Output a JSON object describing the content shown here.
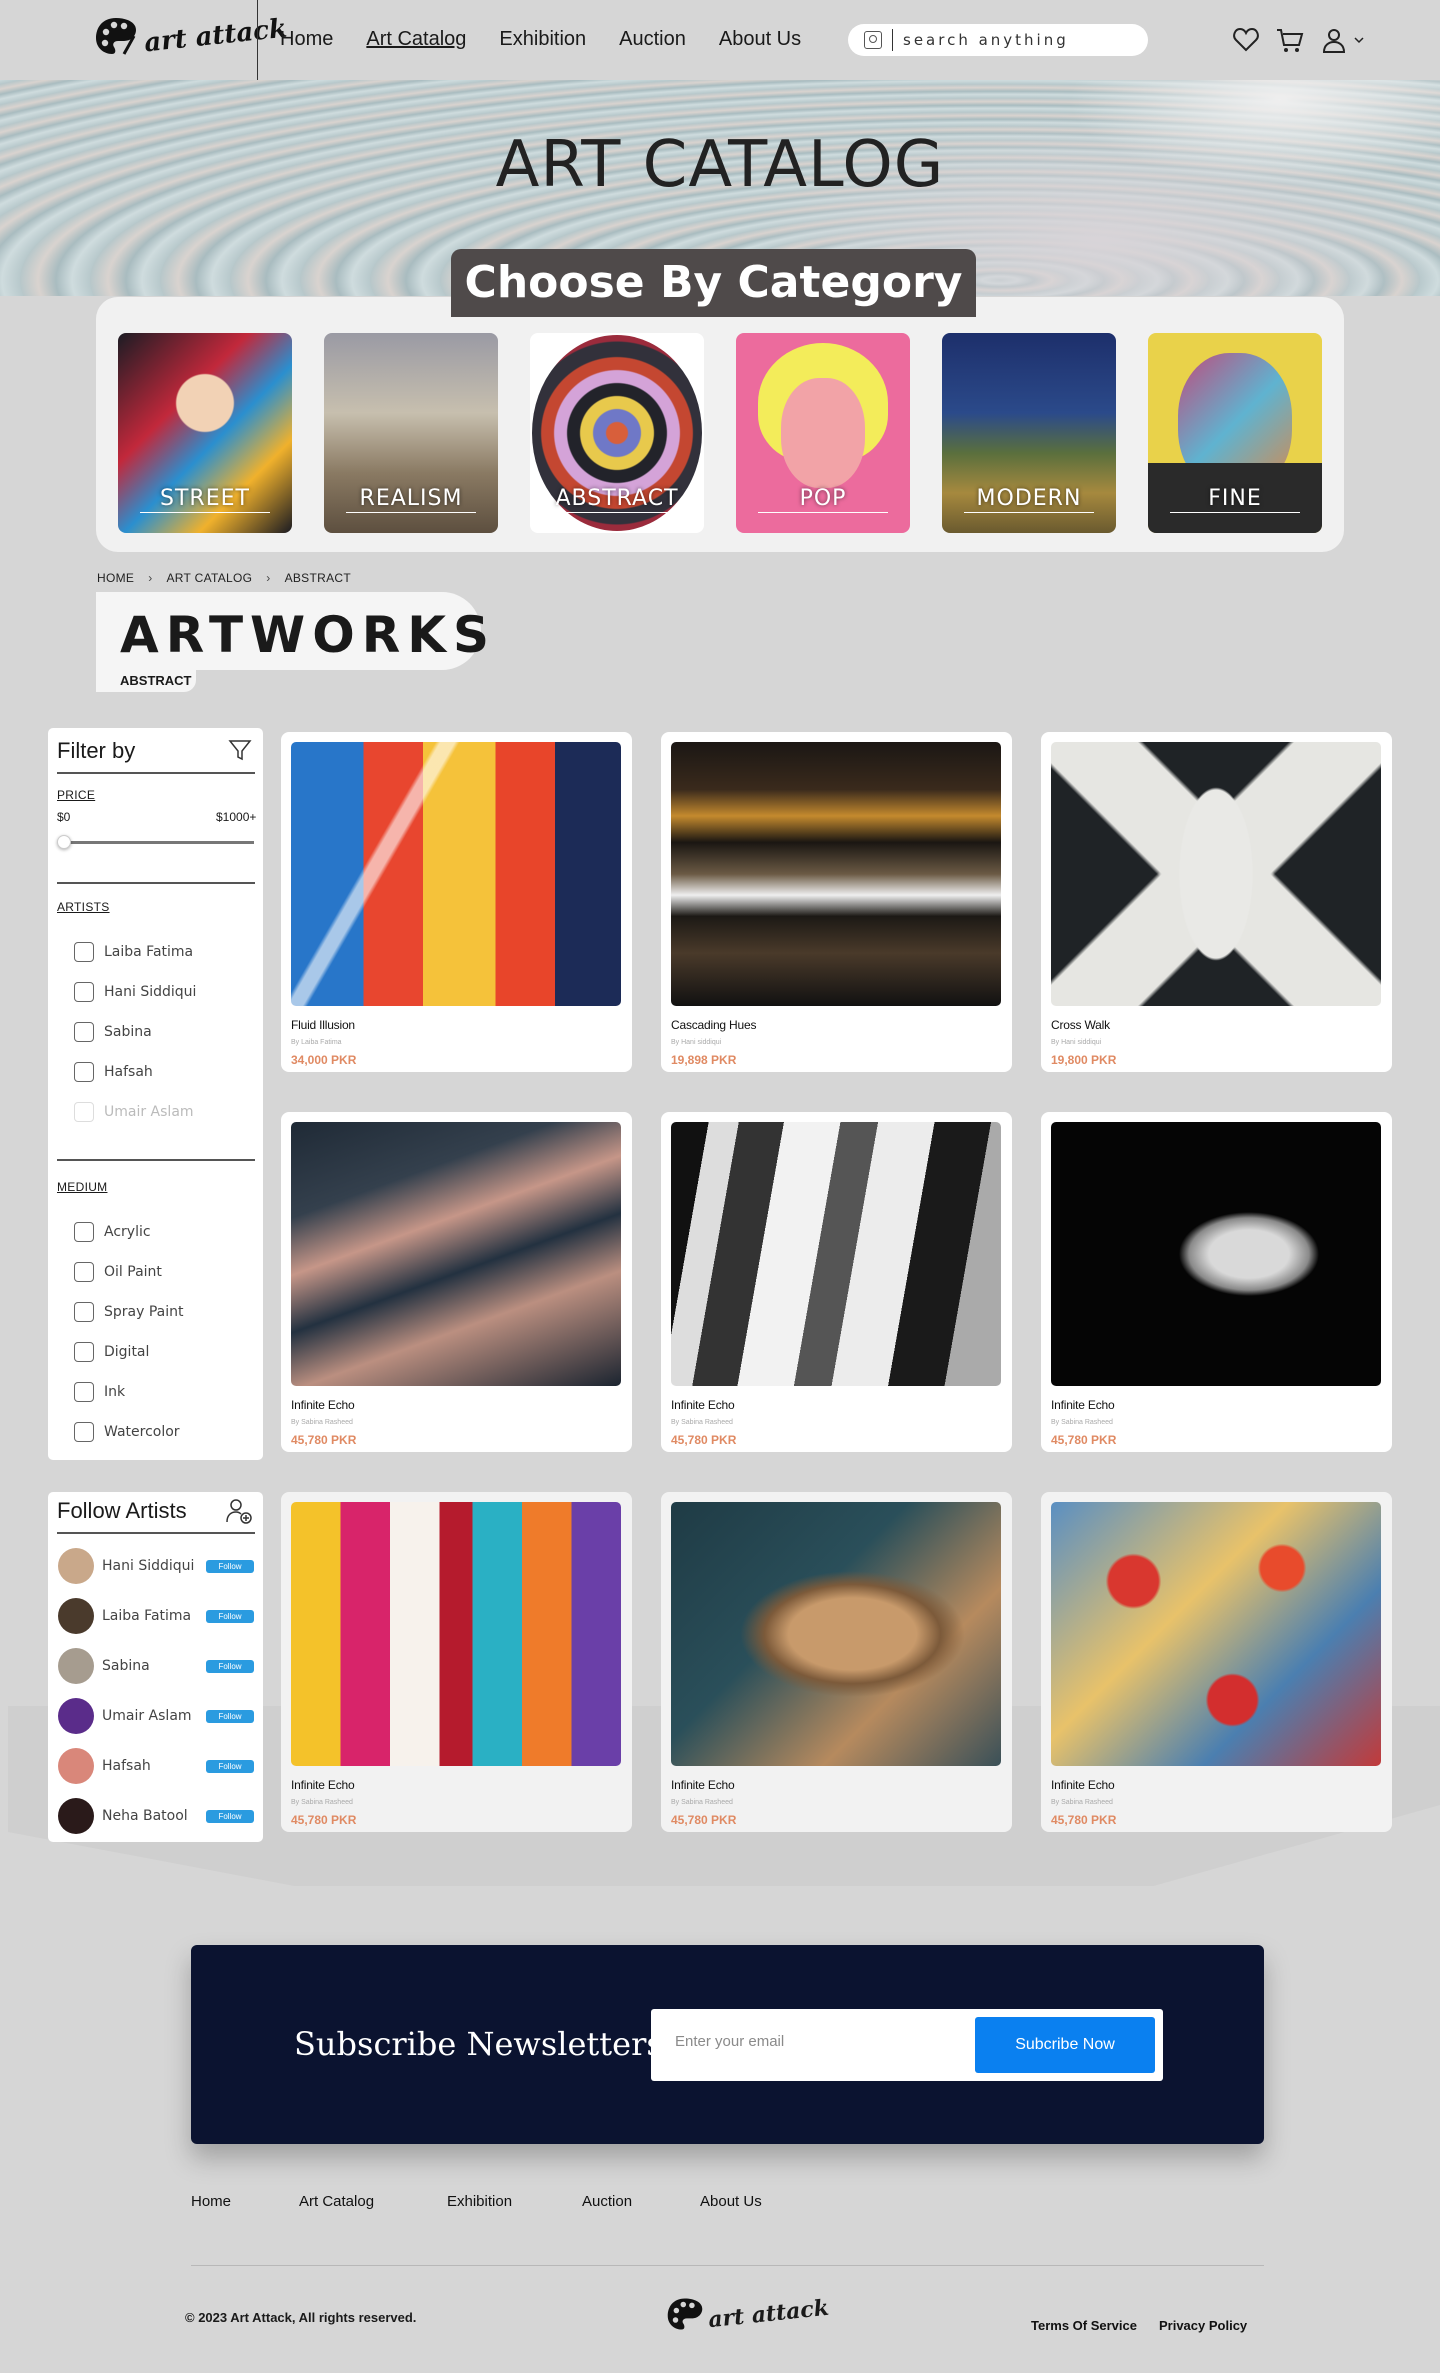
{
  "header": {
    "logo_text": "art attack",
    "nav": [
      {
        "label": "Home",
        "active": false
      },
      {
        "label": "Art Catalog",
        "active": true
      },
      {
        "label": "Exhibition",
        "active": false
      },
      {
        "label": "Auction",
        "active": false
      },
      {
        "label": "About Us",
        "active": false
      }
    ],
    "search_placeholder": "search anything",
    "icons": [
      "heart-icon",
      "cart-icon",
      "user-icon",
      "chevron-down-icon"
    ]
  },
  "hero": {
    "title": "ART CATALOG",
    "subtitle": "Choose By Category"
  },
  "categories": [
    {
      "label": "STREET"
    },
    {
      "label": "REALISM"
    },
    {
      "label": "ABSTRACT"
    },
    {
      "label": "POP"
    },
    {
      "label": "MODERN"
    },
    {
      "label": "FINE"
    }
  ],
  "breadcrumb": [
    "HOME",
    "ART CATALOG",
    "ABSTRACT"
  ],
  "section": {
    "title": "ARTWORKS",
    "tag": "ABSTRACT"
  },
  "filter": {
    "title": "Filter by",
    "price_label": "PRICE",
    "price_min": "$0",
    "price_max": "$1000+",
    "price_value": 0,
    "artists_label": "ARTISTS",
    "artists": [
      "Laiba Fatima",
      "Hani Siddiqui",
      "Sabina",
      "Hafsah",
      "Umair Aslam"
    ],
    "medium_label": "MEDIUM",
    "mediums": [
      "Acrylic",
      "Oil Paint",
      "Spray Paint",
      "Digital",
      "Ink",
      "Watercolor"
    ]
  },
  "follow": {
    "title": "Follow Artists",
    "button_label": "Follow",
    "artists": [
      {
        "name": "Hani Siddiqui",
        "color": "#c9a88a"
      },
      {
        "name": "Laiba Fatima",
        "color": "#4a3a2c"
      },
      {
        "name": "Sabina",
        "color": "#a69c8f"
      },
      {
        "name": "Umair Aslam",
        "color": "#5a2c8a"
      },
      {
        "name": "Hafsah",
        "color": "#d9877a"
      },
      {
        "name": "Neha Batool",
        "color": "#2a1a1a"
      }
    ]
  },
  "artworks": [
    {
      "title": "Fluid Illusion",
      "by": "By Laiba Fatima",
      "price": "34,000 PKR"
    },
    {
      "title": "Cascading Hues",
      "by": "By Hani siddiqui",
      "price": "19,898 PKR"
    },
    {
      "title": "Cross Walk",
      "by": "By Hani siddiqui",
      "price": "19,800 PKR"
    },
    {
      "title": "Infinite Echo",
      "by": "By Sabina Rasheed",
      "price": "45,780 PKR"
    },
    {
      "title": "Infinite Echo",
      "by": "By Sabina Rasheed",
      "price": "45,780 PKR"
    },
    {
      "title": "Infinite Echo",
      "by": "By Sabina Rasheed",
      "price": "45,780 PKR"
    },
    {
      "title": "Infinite Echo",
      "by": "By Sabina Rasheed",
      "price": "45,780 PKR"
    },
    {
      "title": "Infinite Echo",
      "by": "By Sabina Rasheed",
      "price": "45,780 PKR"
    },
    {
      "title": "Infinite Echo",
      "by": "By Sabina Rasheed",
      "price": "45,780 PKR"
    }
  ],
  "newsletter": {
    "title": "Subscribe Newsletters",
    "placeholder": "Enter your email",
    "button": "Subcribe Now"
  },
  "footer": {
    "nav": [
      "Home",
      "Art Catalog",
      "Exhibition",
      "Auction",
      "About Us"
    ],
    "copyright": "© 2023 Art Attack, All rights reserved.",
    "logo_text": "art attack",
    "links": [
      "Terms Of Service",
      "Privacy Policy"
    ]
  },
  "colors": {
    "page_bg": "#d6d6d6",
    "price": "#e08a63",
    "follow_button": "#2a9be0",
    "newsletter_bg": "#0b1330",
    "newsletter_button": "#0a80f0",
    "category_banner": "#4f4a4a"
  }
}
